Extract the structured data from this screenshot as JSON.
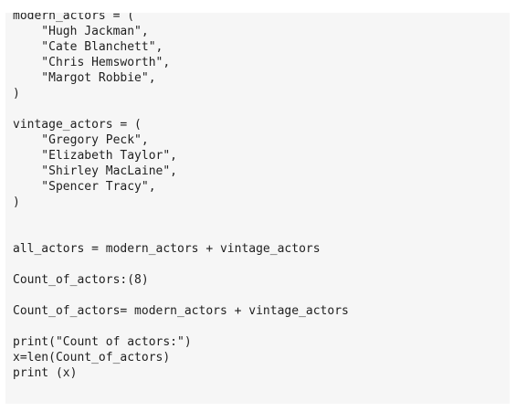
{
  "code": {
    "lines": [
      "modern_actors = (",
      "    \"Hugh Jackman\",",
      "    \"Cate Blanchett\",",
      "    \"Chris Hemsworth\",",
      "    \"Margot Robbie\",",
      ")",
      "",
      "vintage_actors = (",
      "    \"Gregory Peck\",",
      "    \"Elizabeth Taylor\",",
      "    \"Shirley MacLaine\",",
      "    \"Spencer Tracy\",",
      ")",
      "",
      "",
      "all_actors = modern_actors + vintage_actors",
      "",
      "Count_of_actors:(8)",
      "",
      "Count_of_actors= modern_actors + vintage_actors",
      "",
      "print(\"Count of actors:\")",
      "x=len(Count_of_actors)",
      "print (x)"
    ]
  }
}
